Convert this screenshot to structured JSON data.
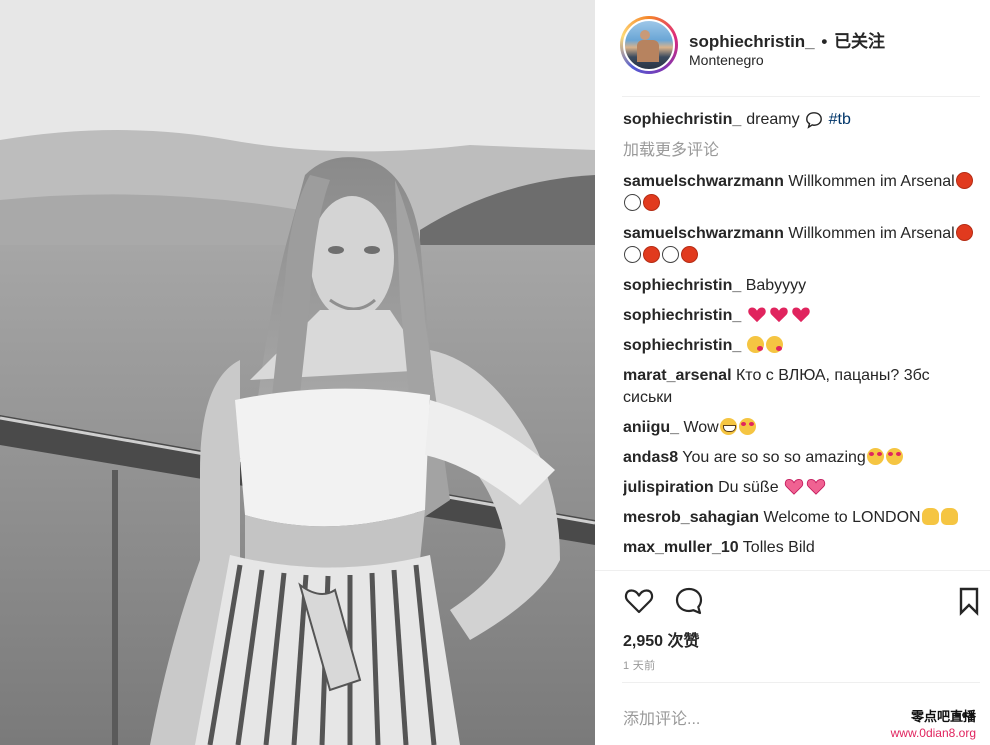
{
  "header": {
    "username": "sophiechristin_",
    "dot": "•",
    "follow_status": "已关注",
    "location": "Montenegro"
  },
  "caption": {
    "username": "sophiechristin_",
    "text": "dreamy",
    "hashtag": "#tb"
  },
  "load_more": "加载更多评论",
  "comments": [
    {
      "user": "samuelschwarzmann",
      "text": "Willkommen im Arsenal"
    },
    {
      "user": "samuelschwarzmann",
      "text": "Willkommen im Arsenal"
    },
    {
      "user": "sophiechristin_",
      "text": "Babyyyy"
    },
    {
      "user": "sophiechristin_",
      "text": ""
    },
    {
      "user": "sophiechristin_",
      "text": ""
    },
    {
      "user": "marat_arsenal",
      "text": "Кто с ВЛЮА, пацаны? 3бс сиськи"
    },
    {
      "user": "aniigu_",
      "text": "Wow"
    },
    {
      "user": "andas8",
      "text": "You are so so so amazing"
    },
    {
      "user": "julispiration",
      "text": "Du süße"
    },
    {
      "user": "mesrob_sahagian",
      "text": "Welcome to LONDON"
    },
    {
      "user": "max_muller_10",
      "text": "Tolles Bild"
    }
  ],
  "actions": {
    "likes": "2,950 次赞",
    "time": "1 天前",
    "add_comment_placeholder": "添加评论...",
    "more": "•••"
  },
  "icons": {
    "like": "heart-outline-icon",
    "comment": "comment-bubble-icon",
    "save": "bookmark-icon"
  },
  "watermark": {
    "line1": "零点吧直播",
    "line2": "www.0dian8.org"
  },
  "colors": {
    "hashtag": "#003569",
    "muted": "#999999",
    "heart": "#e0245e"
  }
}
